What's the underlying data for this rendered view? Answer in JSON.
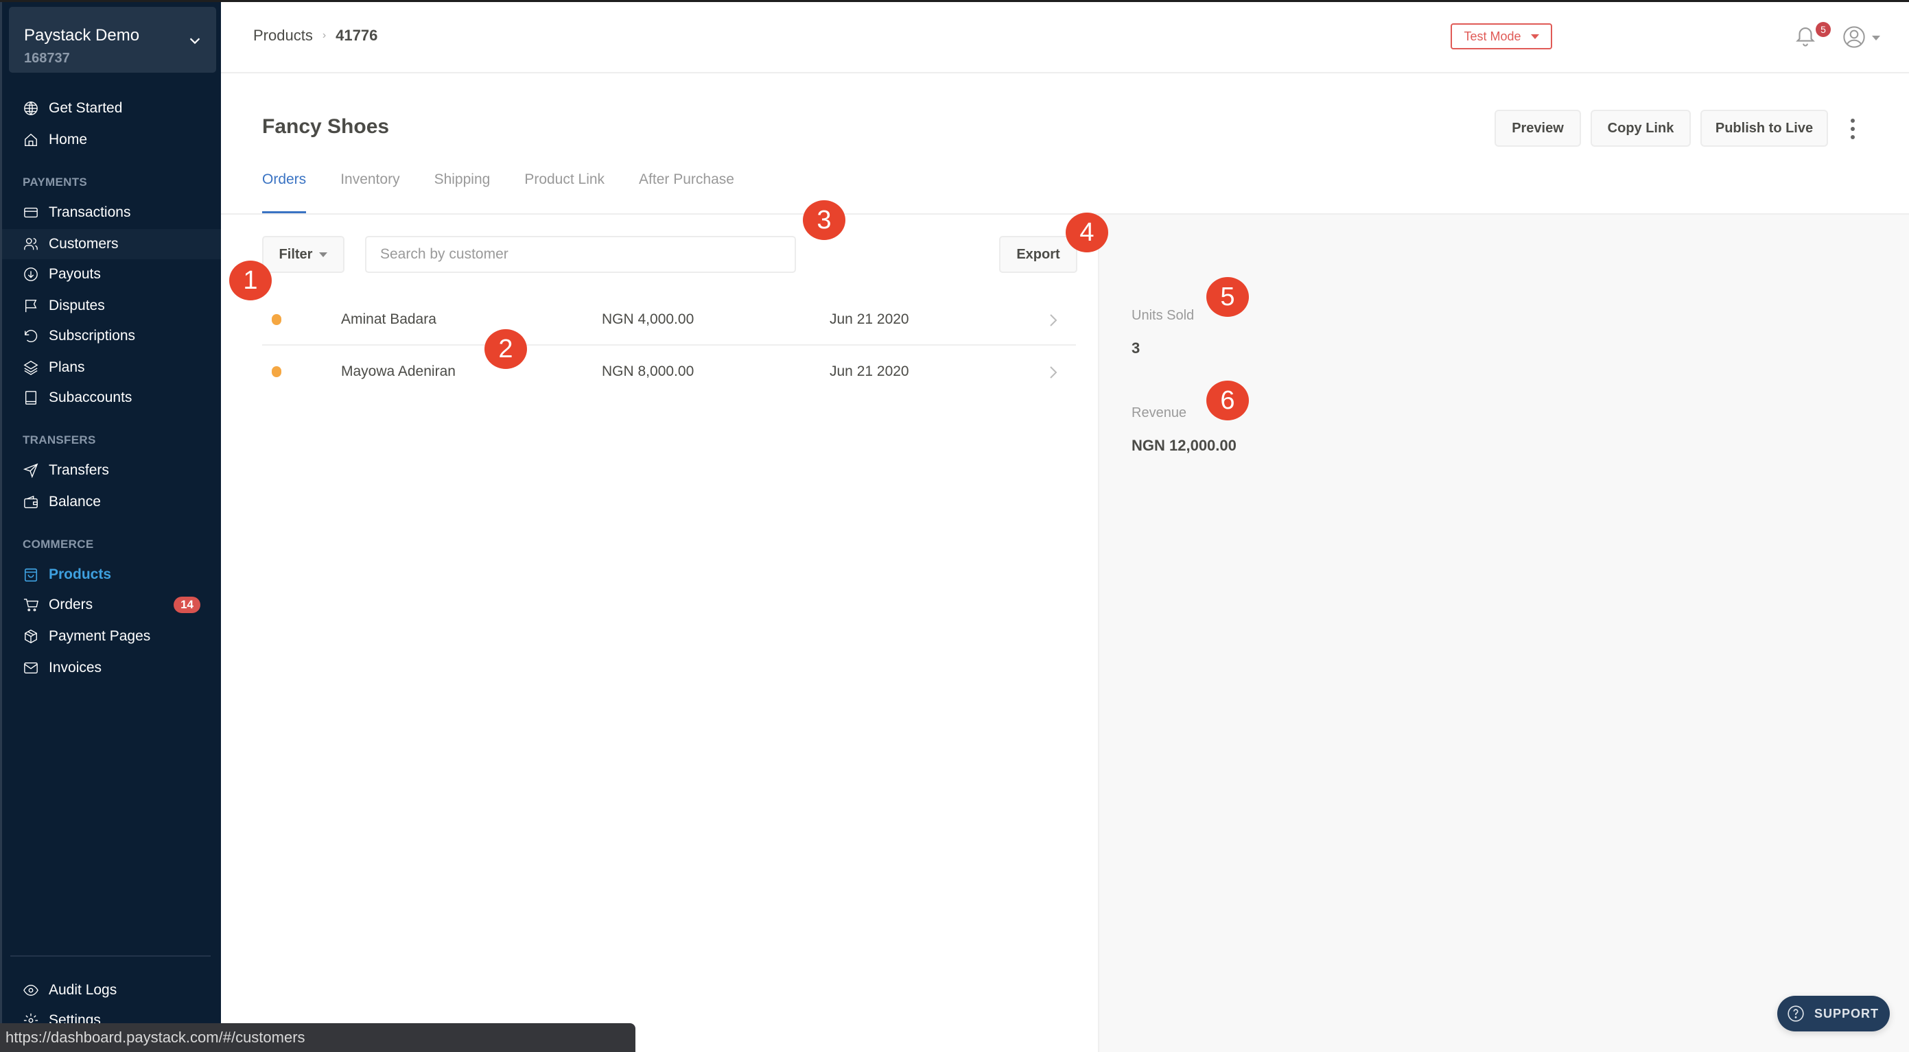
{
  "sidebar": {
    "org": {
      "name": "Paystack Demo",
      "id": "168737"
    },
    "top_items": [
      {
        "label": "Get Started",
        "icon": "globe-icon"
      },
      {
        "label": "Home",
        "icon": "home-icon"
      }
    ],
    "sections": [
      {
        "title": "PAYMENTS",
        "items": [
          {
            "label": "Transactions",
            "icon": "credit-card-icon"
          },
          {
            "label": "Customers",
            "icon": "users-icon",
            "hover": true
          },
          {
            "label": "Payouts",
            "icon": "arrow-down-circle-icon"
          },
          {
            "label": "Disputes",
            "icon": "flag-icon"
          },
          {
            "label": "Subscriptions",
            "icon": "refresh-icon"
          },
          {
            "label": "Plans",
            "icon": "layers-icon"
          },
          {
            "label": "Subaccounts",
            "icon": "book-icon"
          }
        ]
      },
      {
        "title": "TRANSFERS",
        "items": [
          {
            "label": "Transfers",
            "icon": "send-icon"
          },
          {
            "label": "Balance",
            "icon": "wallet-icon"
          }
        ]
      },
      {
        "title": "COMMERCE",
        "items": [
          {
            "label": "Products",
            "icon": "shopping-bag-icon",
            "active": true
          },
          {
            "label": "Orders",
            "icon": "cart-icon",
            "badge": "14"
          },
          {
            "label": "Payment Pages",
            "icon": "box-icon"
          },
          {
            "label": "Invoices",
            "icon": "mail-icon"
          }
        ]
      }
    ],
    "bottom_items": [
      {
        "label": "Audit Logs",
        "icon": "eye-icon"
      },
      {
        "label": "Settings",
        "icon": "gear-icon"
      }
    ]
  },
  "header": {
    "breadcrumb": {
      "parent": "Products",
      "separator": "›",
      "current": "41776"
    },
    "mode_label": "Test Mode",
    "notifications_count": "5"
  },
  "product": {
    "title": "Fancy Shoes",
    "actions": {
      "preview": "Preview",
      "copy_link": "Copy Link",
      "publish": "Publish to Live"
    },
    "tabs": [
      {
        "label": "Orders",
        "active": true
      },
      {
        "label": "Inventory"
      },
      {
        "label": "Shipping"
      },
      {
        "label": "Product Link"
      },
      {
        "label": "After Purchase"
      }
    ]
  },
  "orders": {
    "filter_label": "Filter",
    "search_placeholder": "Search by customer",
    "search_value": "",
    "export_label": "Export",
    "rows": [
      {
        "customer": "Aminat Badara",
        "amount": "NGN 4,000.00",
        "date": "Jun 21 2020",
        "status_color": "#f5a742"
      },
      {
        "customer": "Mayowa Adeniran",
        "amount": "NGN 8,000.00",
        "date": "Jun 21 2020",
        "status_color": "#f5a742"
      }
    ]
  },
  "stats": {
    "units_sold_label": "Units Sold",
    "units_sold_value": "3",
    "revenue_label": "Revenue",
    "revenue_value": "NGN 12,000.00"
  },
  "support_label": "SUPPORT",
  "status_url": "https://dashboard.paystack.com/#/customers",
  "markers": [
    "1",
    "2",
    "3",
    "4",
    "5",
    "6"
  ],
  "colors": {
    "accent": "#3a73c3",
    "sidebar_bg": "#0b1e33",
    "active_nav": "#3ea0df",
    "test_mode": "#e05a56",
    "marker": "#e8432c"
  }
}
